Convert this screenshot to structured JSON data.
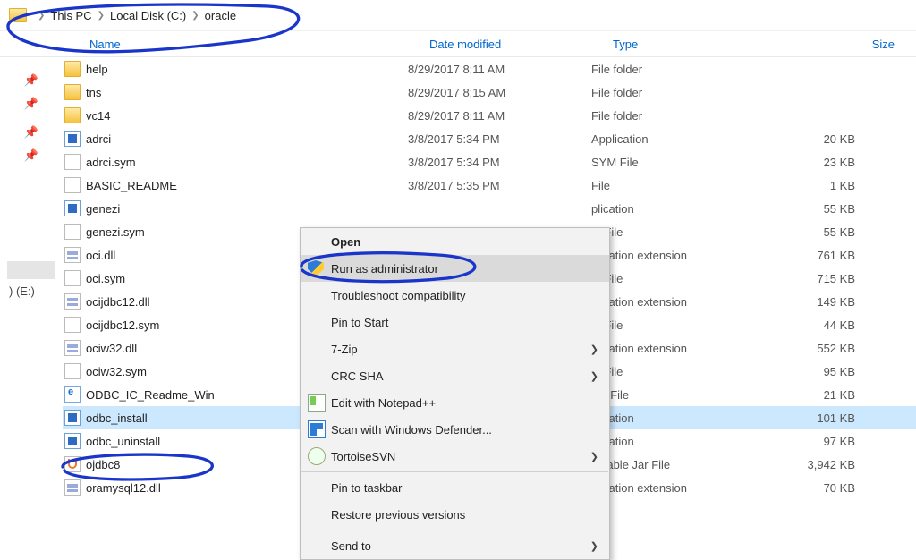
{
  "breadcrumb": [
    "This PC",
    "Local Disk (C:)",
    "oracle"
  ],
  "columns": {
    "name": "Name",
    "date": "Date modified",
    "type": "Type",
    "size": "Size"
  },
  "quick_drive_label": ") (E:)",
  "files": [
    {
      "icon": "folder",
      "name": "help",
      "date": "8/29/2017 8:11 AM",
      "type": "File folder",
      "size": ""
    },
    {
      "icon": "folder",
      "name": "tns",
      "date": "8/29/2017 8:15 AM",
      "type": "File folder",
      "size": ""
    },
    {
      "icon": "folder",
      "name": "vc14",
      "date": "8/29/2017 8:11 AM",
      "type": "File folder",
      "size": ""
    },
    {
      "icon": "app",
      "name": "adrci",
      "date": "3/8/2017 5:34 PM",
      "type": "Application",
      "size": "20 KB"
    },
    {
      "icon": "file",
      "name": "adrci.sym",
      "date": "3/8/2017 5:34 PM",
      "type": "SYM File",
      "size": "23 KB"
    },
    {
      "icon": "file",
      "name": "BASIC_README",
      "date": "3/8/2017 5:35 PM",
      "type": "File",
      "size": "1 KB"
    },
    {
      "icon": "app",
      "name": "genezi",
      "date": "",
      "type": "plication",
      "size": "55 KB"
    },
    {
      "icon": "file",
      "name": "genezi.sym",
      "date": "",
      "type": "M File",
      "size": "55 KB"
    },
    {
      "icon": "dll",
      "name": "oci.dll",
      "date": "",
      "type": "plication extension",
      "size": "761 KB"
    },
    {
      "icon": "file",
      "name": "oci.sym",
      "date": "",
      "type": "M File",
      "size": "715 KB"
    },
    {
      "icon": "dll",
      "name": "ocijdbc12.dll",
      "date": "",
      "type": "plication extension",
      "size": "149 KB"
    },
    {
      "icon": "file",
      "name": "ocijdbc12.sym",
      "date": "",
      "type": "M File",
      "size": "44 KB"
    },
    {
      "icon": "dll",
      "name": "ociw32.dll",
      "date": "",
      "type": "plication extension",
      "size": "552 KB"
    },
    {
      "icon": "file",
      "name": "ociw32.sym",
      "date": "",
      "type": "M File",
      "size": "95 KB"
    },
    {
      "icon": "ml",
      "name": "ODBC_IC_Readme_Win",
      "date": "",
      "type": "ML File",
      "size": "21 KB"
    },
    {
      "icon": "app",
      "name": "odbc_install",
      "date": "",
      "type": "plication",
      "size": "101 KB",
      "selected": true
    },
    {
      "icon": "app",
      "name": "odbc_uninstall",
      "date": "",
      "type": "plication",
      "size": "97 KB"
    },
    {
      "icon": "java",
      "name": "ojdbc8",
      "date": "",
      "type": "cutable Jar File",
      "size": "3,942 KB"
    },
    {
      "icon": "dll",
      "name": "oramysql12.dll",
      "date": "",
      "type": "plication extension",
      "size": "70 KB"
    }
  ],
  "context_menu": [
    {
      "kind": "item",
      "label": "Open",
      "bold": true
    },
    {
      "kind": "item",
      "label": "Run as administrator",
      "icon": "shield",
      "hover": true
    },
    {
      "kind": "item",
      "label": "Troubleshoot compatibility"
    },
    {
      "kind": "item",
      "label": "Pin to Start"
    },
    {
      "kind": "item",
      "label": "7-Zip",
      "arrow": true
    },
    {
      "kind": "item",
      "label": "CRC SHA",
      "arrow": true
    },
    {
      "kind": "item",
      "label": "Edit with Notepad++",
      "icon": "npp"
    },
    {
      "kind": "item",
      "label": "Scan with Windows Defender...",
      "icon": "def"
    },
    {
      "kind": "item",
      "label": "TortoiseSVN",
      "icon": "tort",
      "arrow": true
    },
    {
      "kind": "sep"
    },
    {
      "kind": "item",
      "label": "Pin to taskbar"
    },
    {
      "kind": "item",
      "label": "Restore previous versions"
    },
    {
      "kind": "sep"
    },
    {
      "kind": "item",
      "label": "Send to",
      "arrow": true
    }
  ]
}
